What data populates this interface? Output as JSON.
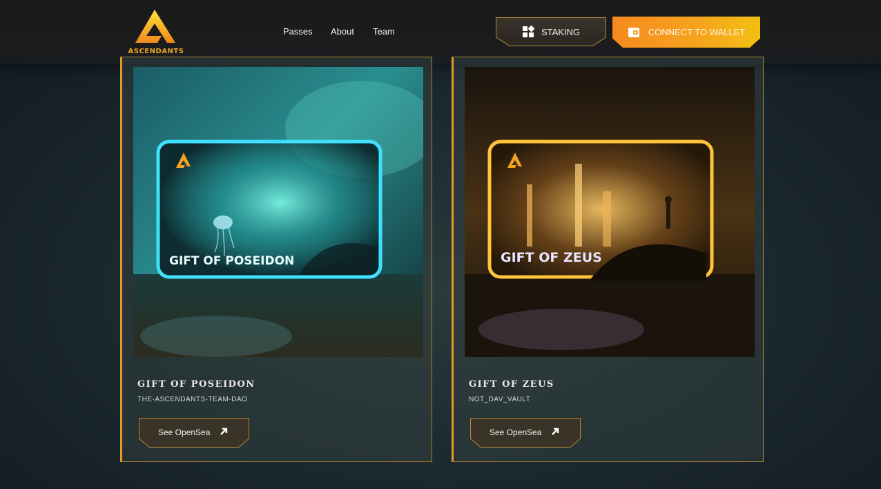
{
  "header": {
    "logo_text": "ASCENDANTS",
    "nav": [
      {
        "label": "Passes"
      },
      {
        "label": "About"
      },
      {
        "label": "Team"
      }
    ],
    "staking_label": "STAKING",
    "connect_label": "CONNECT TO WALLET"
  },
  "cards": [
    {
      "title": "GIFT OF POSEIDON",
      "subtitle": "THE-ASCENDANTS-TEAM-DAO",
      "image_text": "GIFT OF POSEIDON",
      "button_label": "See OpenSea"
    },
    {
      "title": "GIFT OF ZEUS",
      "subtitle": "NOT_DAV_VAULT",
      "image_text": "GIFT OF ZEUS",
      "button_label": "See OpenSea"
    }
  ],
  "colors": {
    "accent_orange": "#f58a1f",
    "accent_yellow": "#f2c012",
    "card_border": "#a88532",
    "poseidon_glow": "#3fe1ff",
    "zeus_glow": "#ffc43a"
  }
}
